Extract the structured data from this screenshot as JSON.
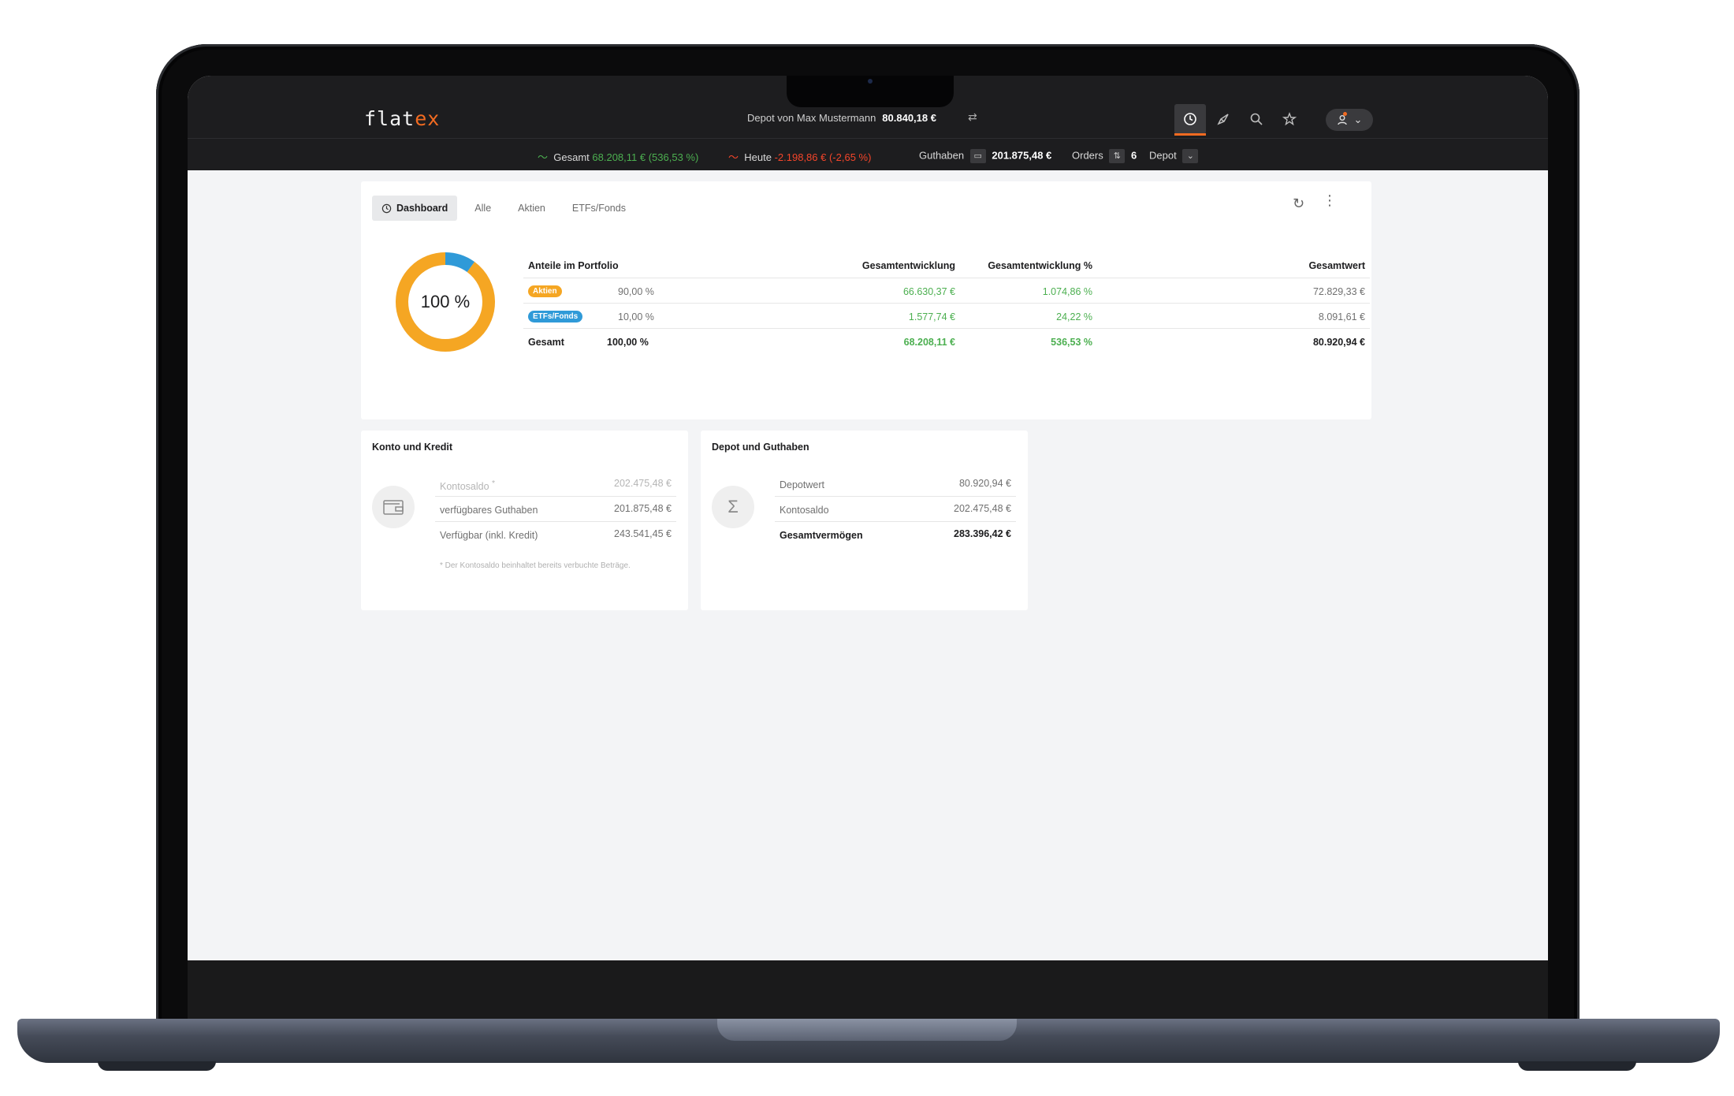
{
  "app": {
    "logo_main": "flat",
    "logo_accent": "ex",
    "depot_label": "Depot von Max Mustermann",
    "depot_value": "80.840,18 €"
  },
  "statusbar": {
    "gesamt_label": "Gesamt",
    "gesamt_value": "68.208,11 € (536,53 %)",
    "heute_label": "Heute",
    "heute_value": "-2.198,86 € (-2,65 %)",
    "guthaben_label": "Guthaben",
    "guthaben_value": "201.875,48 €",
    "orders_label": "Orders",
    "orders_count": "6",
    "depot_label": "Depot"
  },
  "tabs": [
    {
      "label": "Dashboard",
      "active": true
    },
    {
      "label": "Alle",
      "active": false
    },
    {
      "label": "Aktien",
      "active": false
    },
    {
      "label": "ETFs/Fonds",
      "active": false
    }
  ],
  "donut": {
    "label": "100 %",
    "segments": [
      {
        "name": "Aktien",
        "percent": 90,
        "color": "#f5a623"
      },
      {
        "name": "ETFs/Fonds",
        "percent": 10,
        "color": "#2f9ad8"
      }
    ]
  },
  "portfolio": {
    "headers": {
      "anteile": "Anteile im Portfolio",
      "entwicklung": "Gesamtentwicklung",
      "entwicklung_pct": "Gesamtentwicklung %",
      "wert": "Gesamtwert"
    },
    "rows": [
      {
        "label": "Aktien",
        "badge_color": "#f5a623",
        "share": "90,00 %",
        "entwicklung": "66.630,37 €",
        "entwicklung_pct": "1.074,86 %",
        "wert": "72.829,33 €"
      },
      {
        "label": "ETFs/Fonds",
        "badge_color": "#2f9ad8",
        "share": "10,00 %",
        "entwicklung": "1.577,74 €",
        "entwicklung_pct": "24,22 %",
        "wert": "8.091,61 €"
      }
    ],
    "total": {
      "label": "Gesamt",
      "share": "100,00 %",
      "entwicklung": "68.208,11 €",
      "entwicklung_pct": "536,53 %",
      "wert": "80.920,94 €"
    }
  },
  "konto": {
    "title": "Konto und Kredit",
    "rows": [
      {
        "label": "Kontosaldo",
        "marker": "*",
        "value": "202.475,48 €"
      },
      {
        "label": "verfügbares Guthaben",
        "value": "201.875,48 €"
      },
      {
        "label": "Verfügbar (inkl. Kredit)",
        "value": "243.541,45 €"
      }
    ],
    "note": "* Der Kontosaldo beinhaltet bereits verbuchte Beträge."
  },
  "depot": {
    "title": "Depot und Guthaben",
    "rows": [
      {
        "label": "Depotwert",
        "value": "80.920,94 €"
      },
      {
        "label": "Kontosaldo",
        "value": "202.475,48 €"
      },
      {
        "label": "Gesamtvermögen",
        "value": "283.396,42 €"
      }
    ]
  },
  "icons": {
    "nav": [
      "clock-icon",
      "rocket-icon",
      "search-icon",
      "star-icon",
      "user-icon"
    ],
    "konto": "wallet-icon",
    "depot": "sigma-icon"
  },
  "colors": {
    "accent": "#f26b21",
    "positive": "#4caf50",
    "negative": "#f4452a",
    "topbar": "#1d1d1f"
  }
}
